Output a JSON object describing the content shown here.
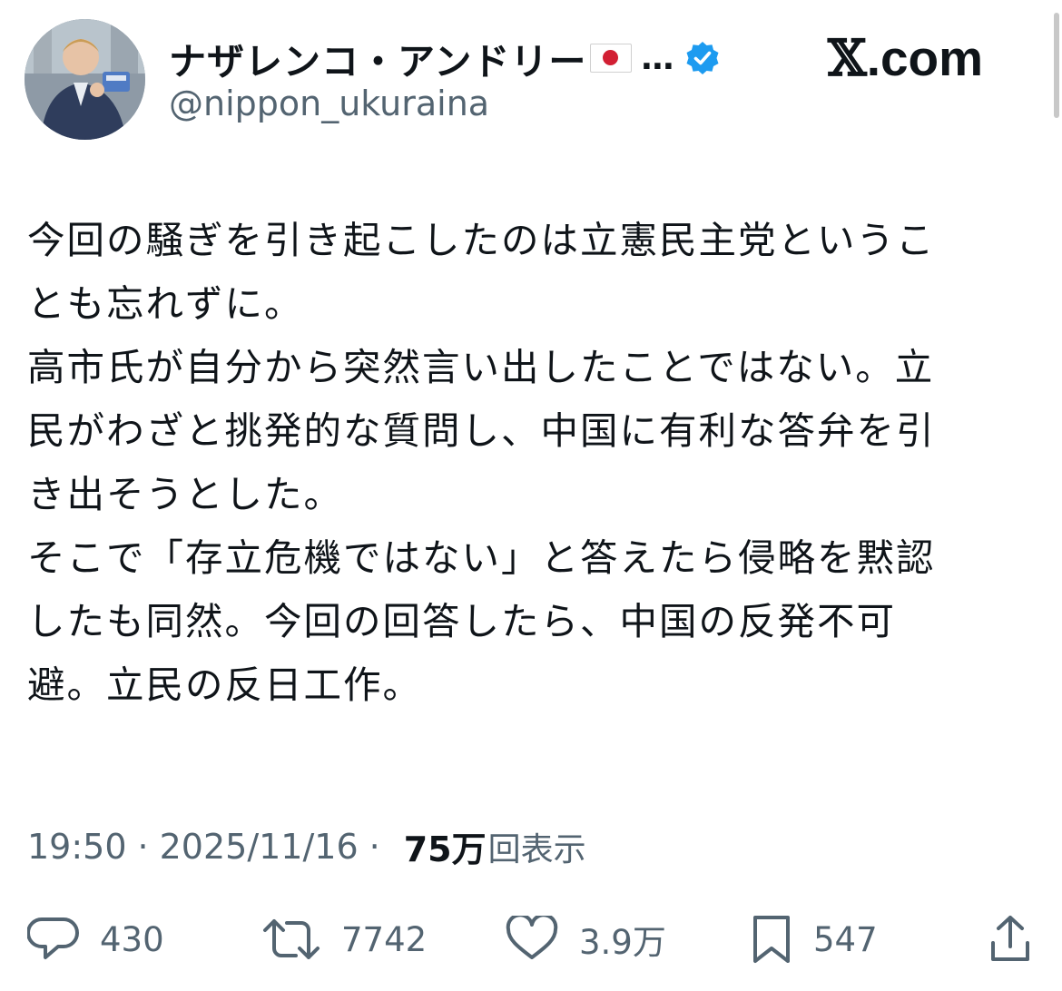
{
  "author": {
    "display_name": "ナザレンコ・アンドリー",
    "handle": "@nippon_ukuraina",
    "truncation": "…",
    "avatar_icon": "avatar-photo",
    "flag_icon": "japan-flag-icon",
    "verified_icon": "verified-badge-icon"
  },
  "brand": {
    "x_glyph": "𝕏",
    "suffix": ".com"
  },
  "tweet": {
    "lines": [
      "今回の騒ぎを引き起こしたのは立憲民主党というこ",
      "とも忘れずに。",
      "高市氏が自分から突然言い出したことではない。立",
      "民がわざと挑発的な質問し、中国に有利な答弁を引",
      "き出そうとした。",
      "そこで「存立危機ではない」と答えたら侵略を黙認",
      "したも同然。今回の回答したら、中国の反発不可",
      "避。立民の反日工作。"
    ]
  },
  "meta": {
    "time": "19:50",
    "separator": "·",
    "date": "2025/11/16",
    "views_count": "75万",
    "views_label": "回表示"
  },
  "actions": {
    "replies": "430",
    "reposts": "7742",
    "likes": "3.9万",
    "bookmarks": "547"
  },
  "colors": {
    "text": "#0f1419",
    "secondary": "#536471",
    "verified": "#1d9bf0",
    "flag_red": "#d21f33"
  }
}
